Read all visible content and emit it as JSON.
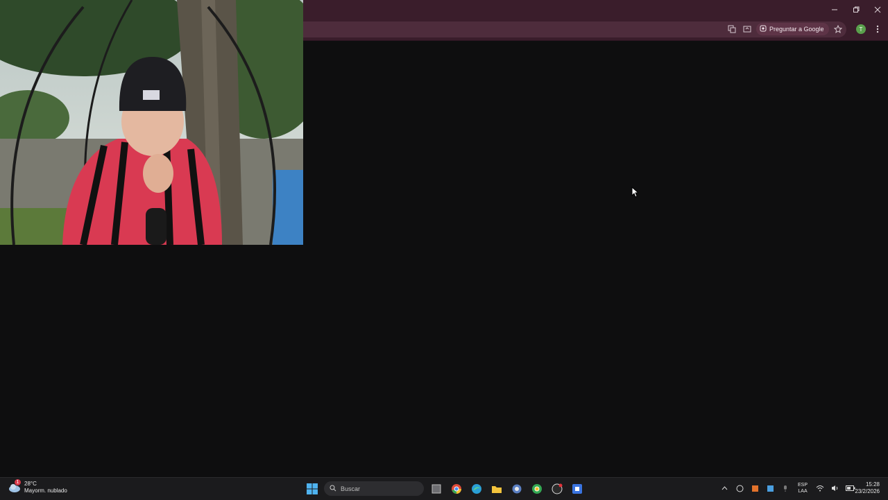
{
  "browser": {
    "ask_google_label": "Preguntar a Google",
    "profile_initial": "T",
    "accent": "#3a1d2b"
  },
  "taskbar": {
    "weather": {
      "temperature": "28°C",
      "condition": "Mayorm. nublado",
      "badge": "1"
    },
    "search_placeholder": "Buscar",
    "language": {
      "line1": "ESP",
      "line2": "LAA"
    },
    "clock": {
      "time": "15:28",
      "date": "23/2/2026"
    }
  },
  "icons": [
    "translate-icon",
    "cast-icon",
    "star-icon",
    "windows-start-icon",
    "chrome-icon",
    "edge-icon",
    "folder-icon",
    "wifi-icon",
    "volume-icon",
    "battery-icon"
  ]
}
